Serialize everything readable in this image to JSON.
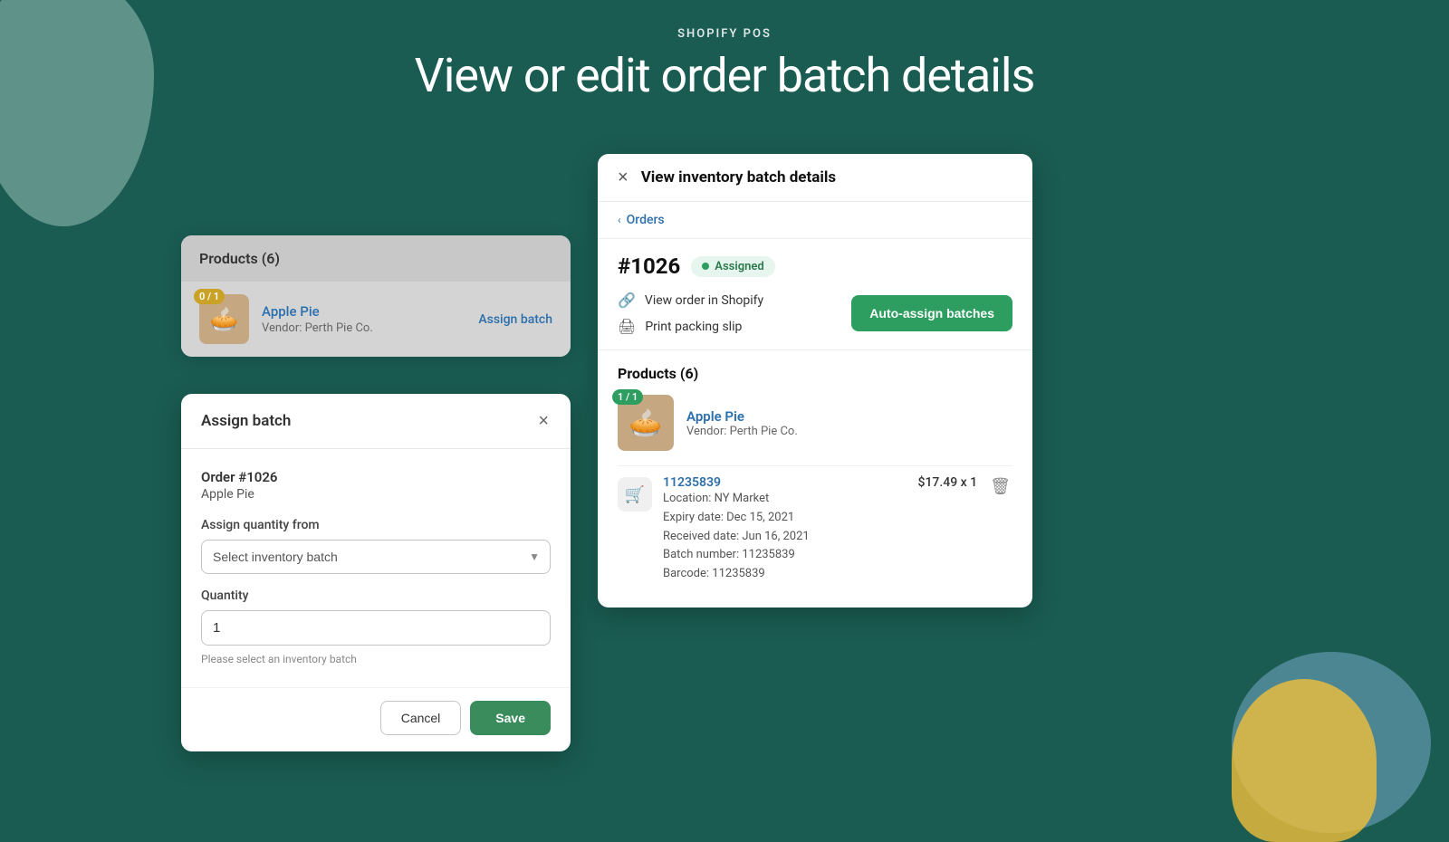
{
  "background": {
    "color": "#1a5c52"
  },
  "header": {
    "subtitle": "SHOPIFY POS",
    "title": "View or edit order batch details"
  },
  "products_card": {
    "title": "Products (6)",
    "product": {
      "badge": "0 / 1",
      "name": "Apple Pie",
      "vendor": "Vendor: Perth Pie Co.",
      "assign_link": "Assign batch",
      "emoji": "🥧"
    }
  },
  "assign_batch_modal": {
    "title": "Assign batch",
    "close_label": "×",
    "order_label": "Order #1026",
    "order_product": "Apple Pie",
    "assign_qty_label": "Assign quantity from",
    "select_placeholder": "Select inventory batch",
    "quantity_label": "Quantity",
    "quantity_value": "1",
    "field_hint": "Please select an inventory batch",
    "cancel_label": "Cancel",
    "save_label": "Save"
  },
  "inventory_panel": {
    "title": "View inventory batch details",
    "close_label": "×",
    "breadcrumb": "Orders",
    "order_number": "#1026",
    "status_badge": "Assigned",
    "view_order_label": "View order in Shopify",
    "print_slip_label": "Print packing slip",
    "auto_assign_label": "Auto-assign batches",
    "products_title": "Products (6)",
    "product": {
      "badge": "1 / 1",
      "name": "Apple Pie",
      "vendor": "Vendor: Perth Pie Co.",
      "emoji": "🥧"
    },
    "batch_item": {
      "id": "11235839",
      "price": "$17.49 x 1",
      "location": "Location: NY Market",
      "expiry": "Expiry date: Dec 15, 2021",
      "received": "Received date: Jun 16, 2021",
      "batch_number": "Batch number: 11235839",
      "barcode": "Barcode: 11235839"
    }
  }
}
